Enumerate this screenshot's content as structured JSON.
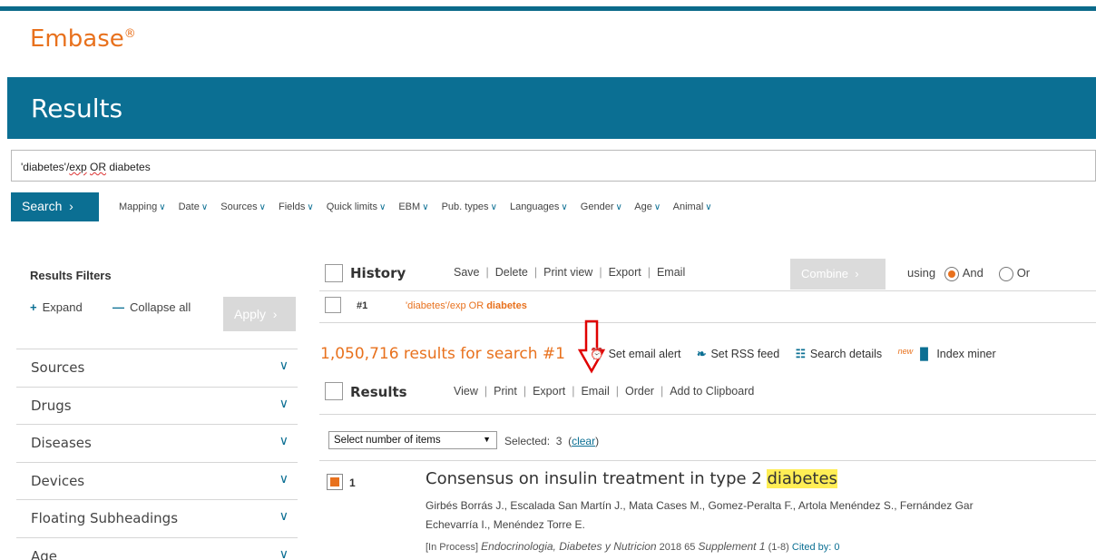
{
  "brand": {
    "name": "Embase",
    "mark": "®"
  },
  "banner": {
    "title": "Results"
  },
  "query": {
    "pre": "'diabetes'/",
    "exp": "exp",
    "mid": " ",
    "or": "OR",
    "post": " diabetes"
  },
  "search_bar": {
    "search_label": "Search",
    "options": [
      "Mapping",
      "Date",
      "Sources",
      "Fields",
      "Quick limits",
      "EBM",
      "Pub. types",
      "Languages",
      "Gender",
      "Age",
      "Animal"
    ]
  },
  "filters_panel": {
    "title": "Results Filters",
    "expand": "Expand",
    "collapse": "Collapse all",
    "apply": "Apply",
    "items": [
      "Sources",
      "Drugs",
      "Diseases",
      "Devices",
      "Floating Subheadings",
      "Age"
    ]
  },
  "history": {
    "label": "History",
    "actions": [
      "Save",
      "Delete",
      "Print view",
      "Export",
      "Email"
    ],
    "combine": "Combine",
    "using": "using",
    "and": "And",
    "or": "Or",
    "entry": {
      "num": "#1",
      "q_pre": "'diabetes'/exp OR ",
      "q_term": "diabetes"
    }
  },
  "summary": {
    "count_text": "1,050,716 results for search #1",
    "tools": {
      "alert": "Set email alert",
      "rss": "Set RSS feed",
      "details": "Search details",
      "new_badge": "new",
      "miner": "Index miner"
    }
  },
  "results": {
    "label": "Results",
    "actions": [
      "View",
      "Print",
      "Export",
      "Email",
      "Order",
      "Add to Clipboard"
    ],
    "select_value": "Select number of items",
    "selected_prefix": "Selected:",
    "selected_count": "3",
    "clear": "clear",
    "items": [
      {
        "num": "1",
        "title_pre": "Consensus on insulin treatment in type 2 ",
        "title_hl": "diabetes",
        "authors_1": "Girbés Borrás J., Escalada San Martín J., Mata Cases M., Gomez-Peralta F., Artola Menéndez S., Fernández Gar",
        "authors_2": "Echevarría I., Menéndez Torre E.",
        "status": "[In Process]",
        "journal": "Endocrinologia, Diabetes y Nutricion",
        "year_vol": "2018 65",
        "supplement": "Supplement 1",
        "pages": "(1-8)",
        "cited": "Cited by: 0"
      }
    ]
  },
  "colors": {
    "brand_orange": "#e8711d",
    "teal": "#0b6f93",
    "highlight": "#ffee55",
    "arrow_red": "#e00000"
  }
}
